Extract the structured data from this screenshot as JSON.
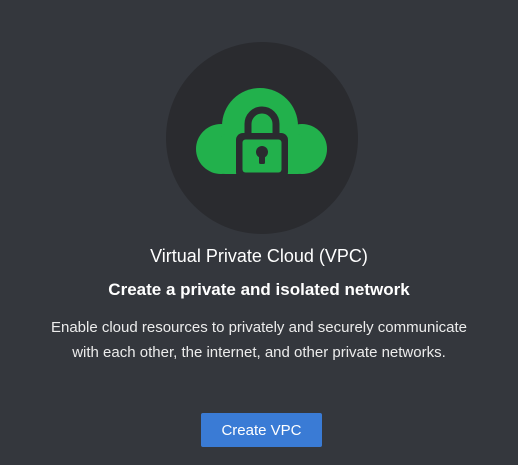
{
  "empty_state": {
    "title": "Virtual Private Cloud (VPC)",
    "subtitle": "Create a private and isolated network",
    "description": "Enable cloud resources to privately and securely communicate with each other, the internet, and other private networks.",
    "icon": "cloud-lock-icon",
    "primary_action_label": "Create VPC"
  },
  "colors": {
    "background": "#34373d",
    "icon_circle": "#2a2b2f",
    "icon_green": "#22b14c",
    "button": "#3a7bd5"
  }
}
